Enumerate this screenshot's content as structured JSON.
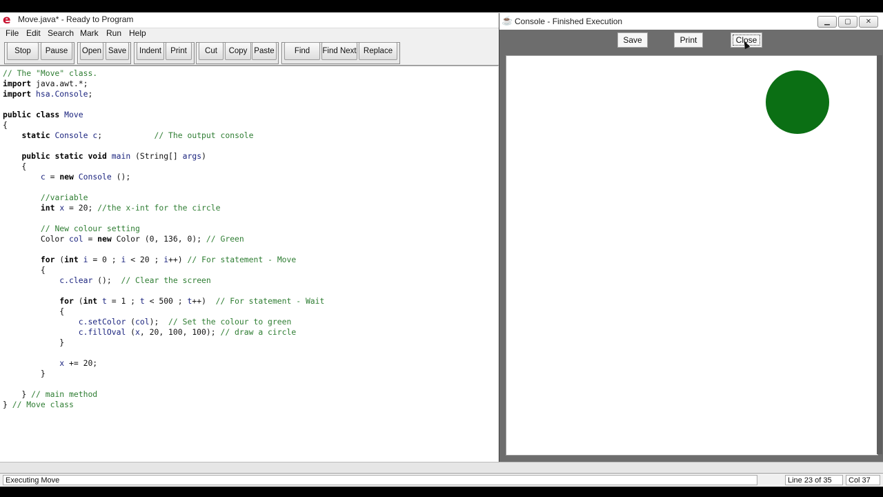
{
  "editor": {
    "title": "Move.java* - Ready to Program",
    "app_icon": "e",
    "menu": [
      "File",
      "Edit",
      "Search",
      "Mark",
      "Run",
      "Help"
    ],
    "toolbar": [
      "Stop",
      "Pause",
      "Open",
      "Save",
      "Indent",
      "Print",
      "Cut",
      "Copy",
      "Paste",
      "Find",
      "Find Next",
      "Replace"
    ],
    "code": [
      "// The \"Move\" class.",
      "import java.awt.*;",
      "import hsa.Console;",
      "",
      "public class Move",
      "{",
      "    static Console c;           // The output console",
      "",
      "    public static void main (String[] args)",
      "    {",
      "        c = new Console ();",
      "",
      "        //variable",
      "        int x = 20; //the x-int for the circle",
      "",
      "        // New colour setting",
      "        Color col = new Color (0, 136, 0); // Green",
      "",
      "        for (int i = 0 ; i < 20 ; i++) // For statement - Move",
      "        {",
      "            c.clear ();  // Clear the screen",
      "",
      "            for (int t = 1 ; t < 500 ; t++)  // For statement - Wait",
      "            {",
      "                c.setColor (col);  // Set the colour to green",
      "                c.fillOval (x, 20, 100, 100); // draw a circle",
      "            }",
      "",
      "            x += 20;",
      "        }",
      "",
      "    } // main method",
      "} // Move class"
    ],
    "status": {
      "message": "Executing Move",
      "line": "Line 23 of 35",
      "col": "Col 37"
    }
  },
  "console": {
    "title": "Console - Finished Execution",
    "buttons": [
      "Save",
      "Print",
      "Close"
    ],
    "window_buttons": [
      "minimize",
      "maximize",
      "close"
    ],
    "circle_color": "#0b6f14"
  }
}
